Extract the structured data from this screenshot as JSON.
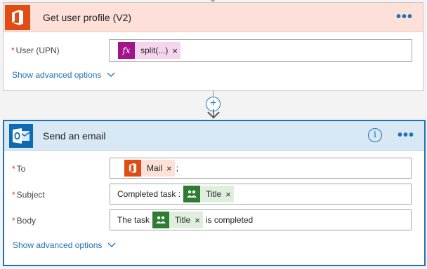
{
  "card1": {
    "title": "Get user profile (V2)",
    "more_label": "•••",
    "fields": [
      {
        "required": "*",
        "label": "User (UPN)",
        "token_label": "split(...)",
        "token_icon": "fx-icon",
        "remove": "×"
      }
    ],
    "advanced": "Show advanced options",
    "advanced_chevron": "⌵"
  },
  "connector": {
    "plus": "+"
  },
  "card2": {
    "title": "Send an email",
    "info": "i",
    "more_label": "•••",
    "to": {
      "required": "*",
      "label": "To",
      "token_label": "Mail",
      "token_icon": "office-icon",
      "remove": "×",
      "suffix": ";"
    },
    "subject": {
      "required": "*",
      "label": "Subject",
      "prefix": "Completed task :",
      "token_label": "Title",
      "token_icon": "sharepoint-icon",
      "remove": "×"
    },
    "body": {
      "required": "*",
      "label": "Body",
      "prefix": "The task",
      "token_label": "Title",
      "token_icon": "sharepoint-icon",
      "remove": "×",
      "suffix": "is completed"
    },
    "advanced": "Show advanced options",
    "advanced_chevron": "⌵"
  },
  "colors": {
    "office": "#e14b14",
    "outlook": "#0f6ab4",
    "accent": "#1f71b8",
    "fx": "#a1148a",
    "sharepoint": "#2e7d32"
  }
}
